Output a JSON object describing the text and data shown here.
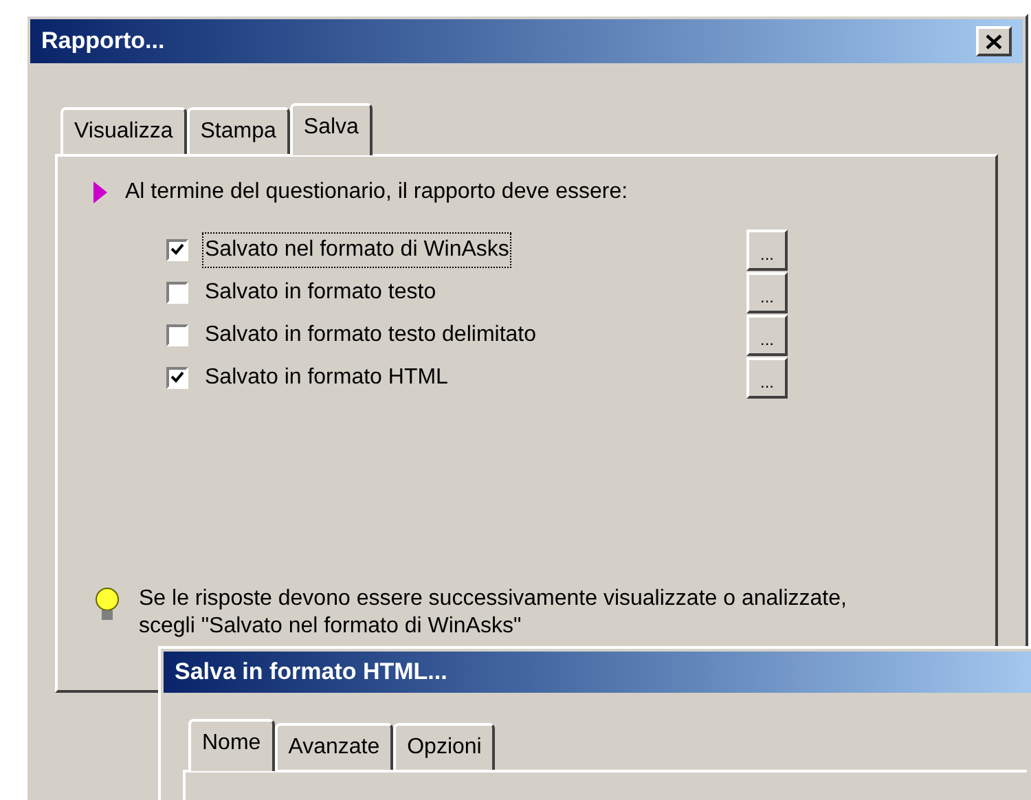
{
  "dialog": {
    "title": "Rapporto...",
    "tabs": [
      {
        "label": "Visualizza",
        "selected": false
      },
      {
        "label": "Stampa",
        "selected": false
      },
      {
        "label": "Salva",
        "selected": true
      }
    ],
    "intro": "Al termine del questionario, il rapporto deve essere:",
    "options": [
      {
        "label": "Salvato nel formato di WinAsks",
        "checked": true,
        "focused": true,
        "button": "..."
      },
      {
        "label": "Salvato in formato testo",
        "checked": false,
        "focused": false,
        "button": "..."
      },
      {
        "label": "Salvato in formato testo delimitato",
        "checked": false,
        "focused": false,
        "button": "..."
      },
      {
        "label": "Salvato in formato HTML",
        "checked": true,
        "focused": false,
        "button": "..."
      }
    ],
    "hint": "Se le risposte devono essere successivamente visualizzate o analizzate, scegli \"Salvato nel formato di WinAsks\""
  },
  "subdialog": {
    "title": "Salva in formato HTML...",
    "tabs": [
      {
        "label": "Nome",
        "selected": true
      },
      {
        "label": "Avanzate",
        "selected": false
      },
      {
        "label": "Opzioni",
        "selected": false
      }
    ]
  }
}
